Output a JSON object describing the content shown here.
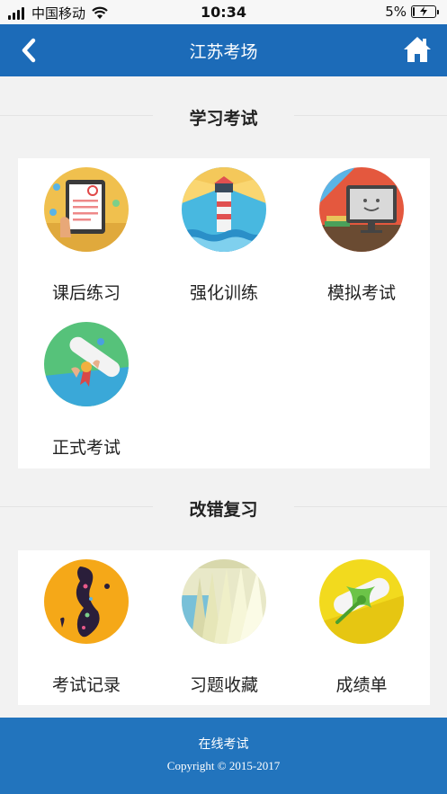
{
  "status_bar": {
    "carrier": "中国移动",
    "time": "10:34",
    "battery_percent": "5%",
    "battery_level": 0.05
  },
  "nav": {
    "title": "江苏考场",
    "back_icon": "chevron-left-icon",
    "home_icon": "home-icon"
  },
  "sections": [
    {
      "title": "学习考试",
      "items": [
        {
          "label": "课后练习",
          "icon": "tablet-exercise-icon"
        },
        {
          "label": "强化训练",
          "icon": "lighthouse-icon"
        },
        {
          "label": "模拟考试",
          "icon": "monitor-icon"
        },
        {
          "label": "正式考试",
          "icon": "diploma-icon"
        }
      ]
    },
    {
      "title": "改错复习",
      "items": [
        {
          "label": "考试记录",
          "icon": "record-icon"
        },
        {
          "label": "习题收藏",
          "icon": "book-pages-icon"
        },
        {
          "label": "成绩单",
          "icon": "certificate-icon"
        }
      ]
    }
  ],
  "footer": {
    "line1": "在线考试",
    "line2": "Copyright © 2015-2017"
  },
  "colors": {
    "nav_bg": "#1c6bb8",
    "footer_bg": "#2274bd",
    "page_bg": "#f2f2f2"
  }
}
